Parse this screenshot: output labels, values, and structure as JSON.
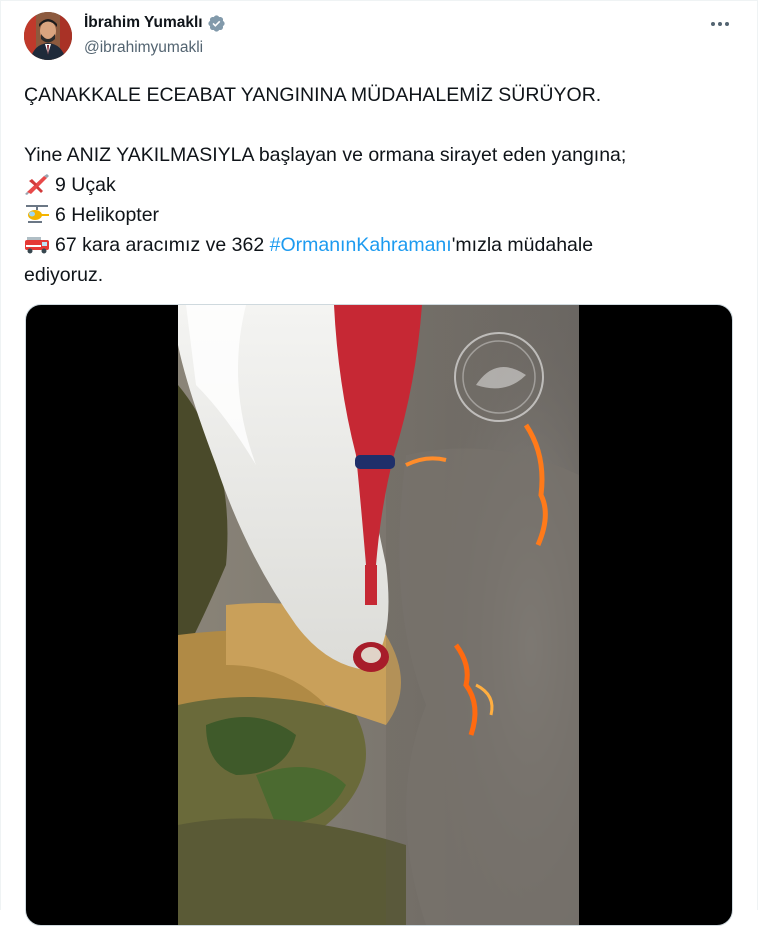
{
  "author": {
    "display_name": "İbrahim Yumaklı",
    "handle": "@ibrahimyumakli",
    "avatar_icon": "profile-photo",
    "verified_icon": "verified-badge-icon"
  },
  "more_icon": "more-horizontal-icon",
  "tweet": {
    "line1": "ÇANAKKALE ECEABAT YANGININA MÜDAHALEMİZ SÜRÜYOR.",
    "line2": "Yine ANIZ YAKILMASIYLA başlayan ve ormana sirayet eden yangına;",
    "item_plane": "9 Uçak",
    "item_helicopter": "6 Helikopter",
    "item_vehicles_prefix": "67 kara aracımız ve 362 ",
    "hashtag": "#OrmanınKahramanı",
    "item_vehicles_suffix": "'mızla müdahale",
    "item_vehicles_wrap": "ediyoruz."
  },
  "emoji_icons": [
    "airplane-emoji",
    "helicopter-emoji",
    "fire-engine-emoji"
  ],
  "media": {
    "type": "video",
    "description_icon": "aerial-firefighting-video"
  },
  "colors": {
    "text": "#0f1419",
    "secondary": "#536471",
    "link": "#1d9bf0",
    "verified": "#829aab"
  }
}
